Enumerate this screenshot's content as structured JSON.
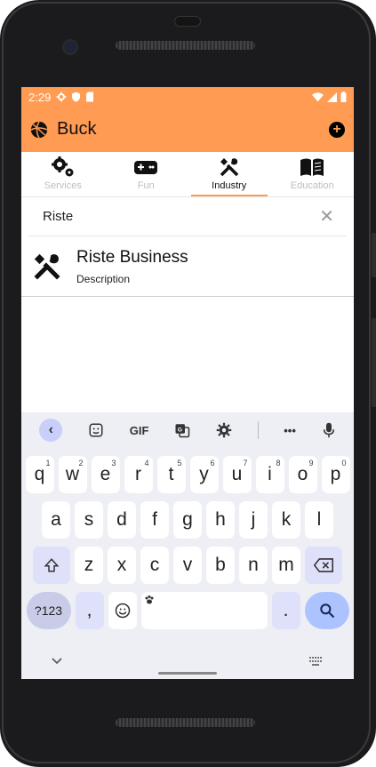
{
  "status": {
    "time": "2:29"
  },
  "appbar": {
    "title": "Buck",
    "add_icon": "plus-circle-icon"
  },
  "tabs": [
    {
      "label": "Services",
      "icon": "gears-icon"
    },
    {
      "label": "Fun",
      "icon": "gamepad-icon"
    },
    {
      "label": "Industry",
      "icon": "tools-icon",
      "active": true
    },
    {
      "label": "Education",
      "icon": "book-icon"
    }
  ],
  "search": {
    "value": "Riste"
  },
  "results": [
    {
      "title": "Riste Business",
      "description": "Description",
      "icon": "tools-icon"
    }
  ],
  "keyboard": {
    "toolbar": [
      "back",
      "sticker",
      "GIF",
      "translate",
      "settings",
      "more",
      "mic"
    ],
    "gif_label": "GIF",
    "more_label": "•••",
    "row1": [
      "q",
      "w",
      "e",
      "r",
      "t",
      "y",
      "u",
      "i",
      "o",
      "p"
    ],
    "row1_sup": [
      "1",
      "2",
      "3",
      "4",
      "5",
      "6",
      "7",
      "8",
      "9",
      "0"
    ],
    "row2": [
      "a",
      "s",
      "d",
      "f",
      "g",
      "h",
      "j",
      "k",
      "l"
    ],
    "row3": [
      "z",
      "x",
      "c",
      "v",
      "b",
      "n",
      "m"
    ],
    "sym_label": "?123",
    "comma": ",",
    "period": "."
  },
  "colors": {
    "accent": "#ff9b52",
    "kb_bg": "#eeeef5",
    "kb_mod": "#dfe1fb",
    "kb_enter": "#adc3ff"
  }
}
